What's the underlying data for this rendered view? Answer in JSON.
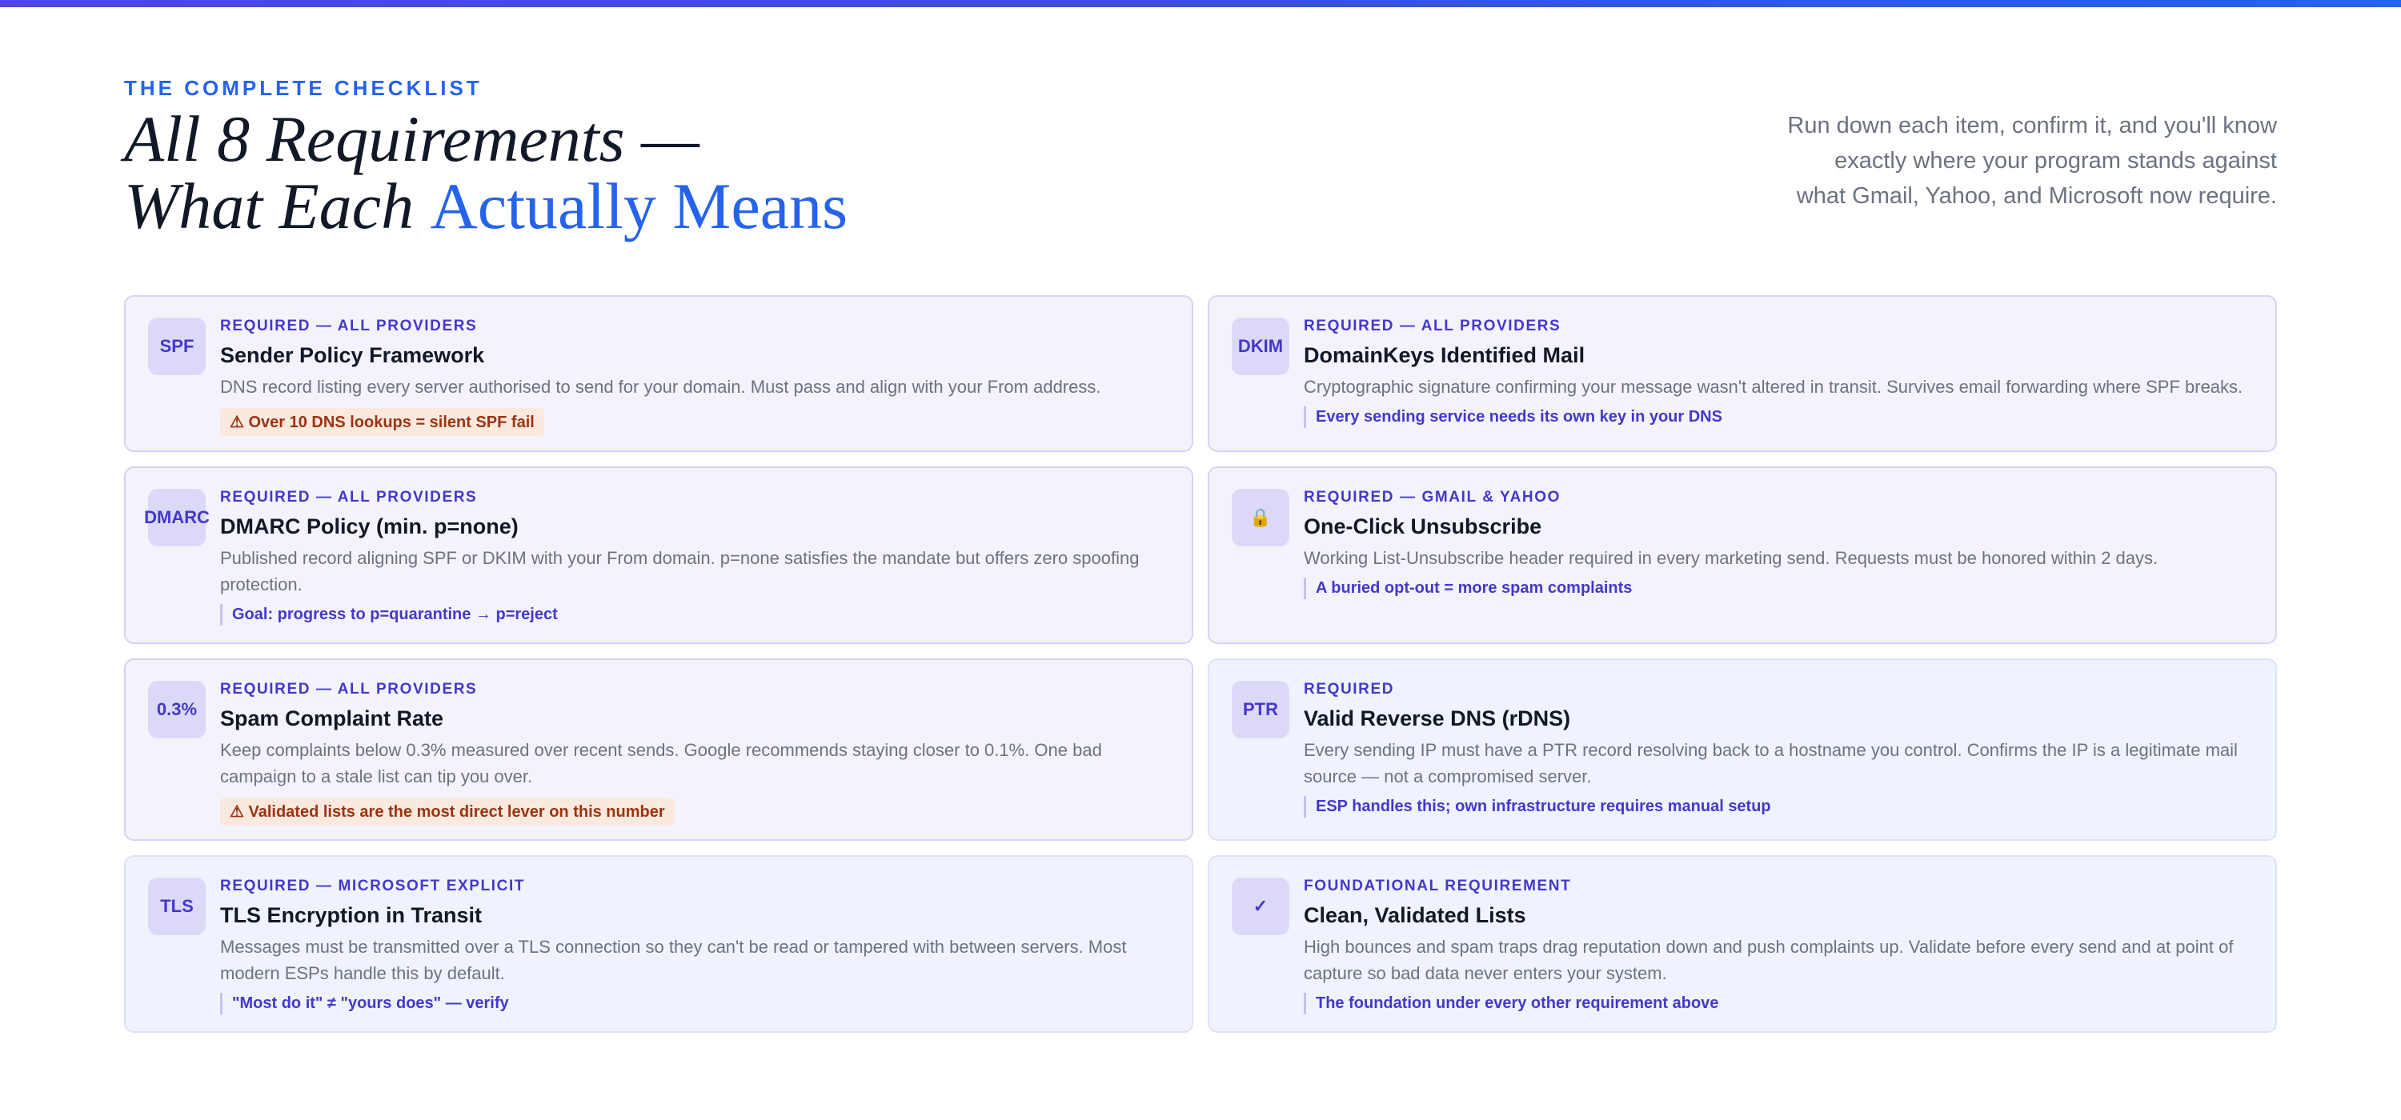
{
  "header": {
    "eyebrow": "THE COMPLETE CHECKLIST",
    "title_line1": "All 8 Requirements —",
    "title_line2_plain": "What Each ",
    "title_line2_accent": "Actually Means",
    "intro": "Run down each item, confirm it, and you'll know exactly where your program stands against what Gmail, Yahoo, and Microsoft now require."
  },
  "cards": {
    "spf": {
      "badge": "SPF",
      "label": "REQUIRED — ALL PROVIDERS",
      "name": "Sender Policy Framework",
      "desc": "DNS record listing every server authorised to send for your domain. Must pass and align with your From address.",
      "note": "⚠ Over 10 DNS lookups = silent SPF fail",
      "note_style": "warning"
    },
    "dkim": {
      "badge": "DKIM",
      "label": "REQUIRED — ALL PROVIDERS",
      "name": "DomainKeys Identified Mail",
      "desc": "Cryptographic signature confirming your message wasn't altered in transit. Survives email forwarding where SPF breaks.",
      "note": "Every sending service needs its own key in your DNS",
      "note_style": "info"
    },
    "dmarc": {
      "badge": "DMARC",
      "label": "REQUIRED — ALL PROVIDERS",
      "name": "DMARC Policy (min. p=none)",
      "desc": "Published record aligning SPF or DKIM with your From domain. p=none satisfies the mandate but offers zero spoofing protection.",
      "note": "Goal: progress to p=quarantine → p=reject",
      "note_style": "info"
    },
    "unsubscribe": {
      "badge_icon": "lock-icon",
      "badge": "🔒",
      "label": "REQUIRED — GMAIL & YAHOO",
      "name": "One-Click Unsubscribe",
      "desc": "Working List-Unsubscribe header required in every marketing send. Requests must be honored within 2 days.",
      "note": "A buried opt-out = more spam complaints",
      "note_style": "info"
    },
    "spam": {
      "badge": "0.3%",
      "label": "REQUIRED — ALL PROVIDERS",
      "name": "Spam Complaint Rate",
      "desc": "Keep complaints below 0.3% measured over recent sends. Google recommends staying closer to 0.1%. One bad campaign to a stale list can tip you over.",
      "note": "⚠ Validated lists are the most direct lever on this number",
      "note_style": "warning"
    },
    "ptr": {
      "badge": "PTR",
      "label": "REQUIRED",
      "name": "Valid Reverse DNS (rDNS)",
      "desc": "Every sending IP must have a PTR record resolving back to a hostname you control. Confirms the IP is a legitimate mail source — not a compromised server.",
      "note": "ESP handles this; own infrastructure requires manual setup",
      "note_style": "info"
    },
    "tls": {
      "badge": "TLS",
      "label": "REQUIRED — MICROSOFT EXPLICIT",
      "name": "TLS Encryption in Transit",
      "desc": "Messages must be transmitted over a TLS connection so they can't be read or tampered with between servers. Most modern ESPs handle this by default.",
      "note": "\"Most do it\" ≠ \"yours does\" — verify",
      "note_style": "info"
    },
    "lists": {
      "badge_icon": "checkmark-icon",
      "badge": "✓",
      "label": "FOUNDATIONAL REQUIREMENT",
      "name": "Clean, Validated Lists",
      "desc": "High bounces and spam traps drag reputation down and push complaints up. Validate before every send and at point of capture so bad data never enters your system.",
      "note": "The foundation under every other requirement above",
      "note_style": "info"
    }
  },
  "colors": {
    "accent": "#2563eb",
    "indigo": "#4338ca",
    "warning_text": "#9a3412",
    "warning_bg": "#fbe9df"
  }
}
